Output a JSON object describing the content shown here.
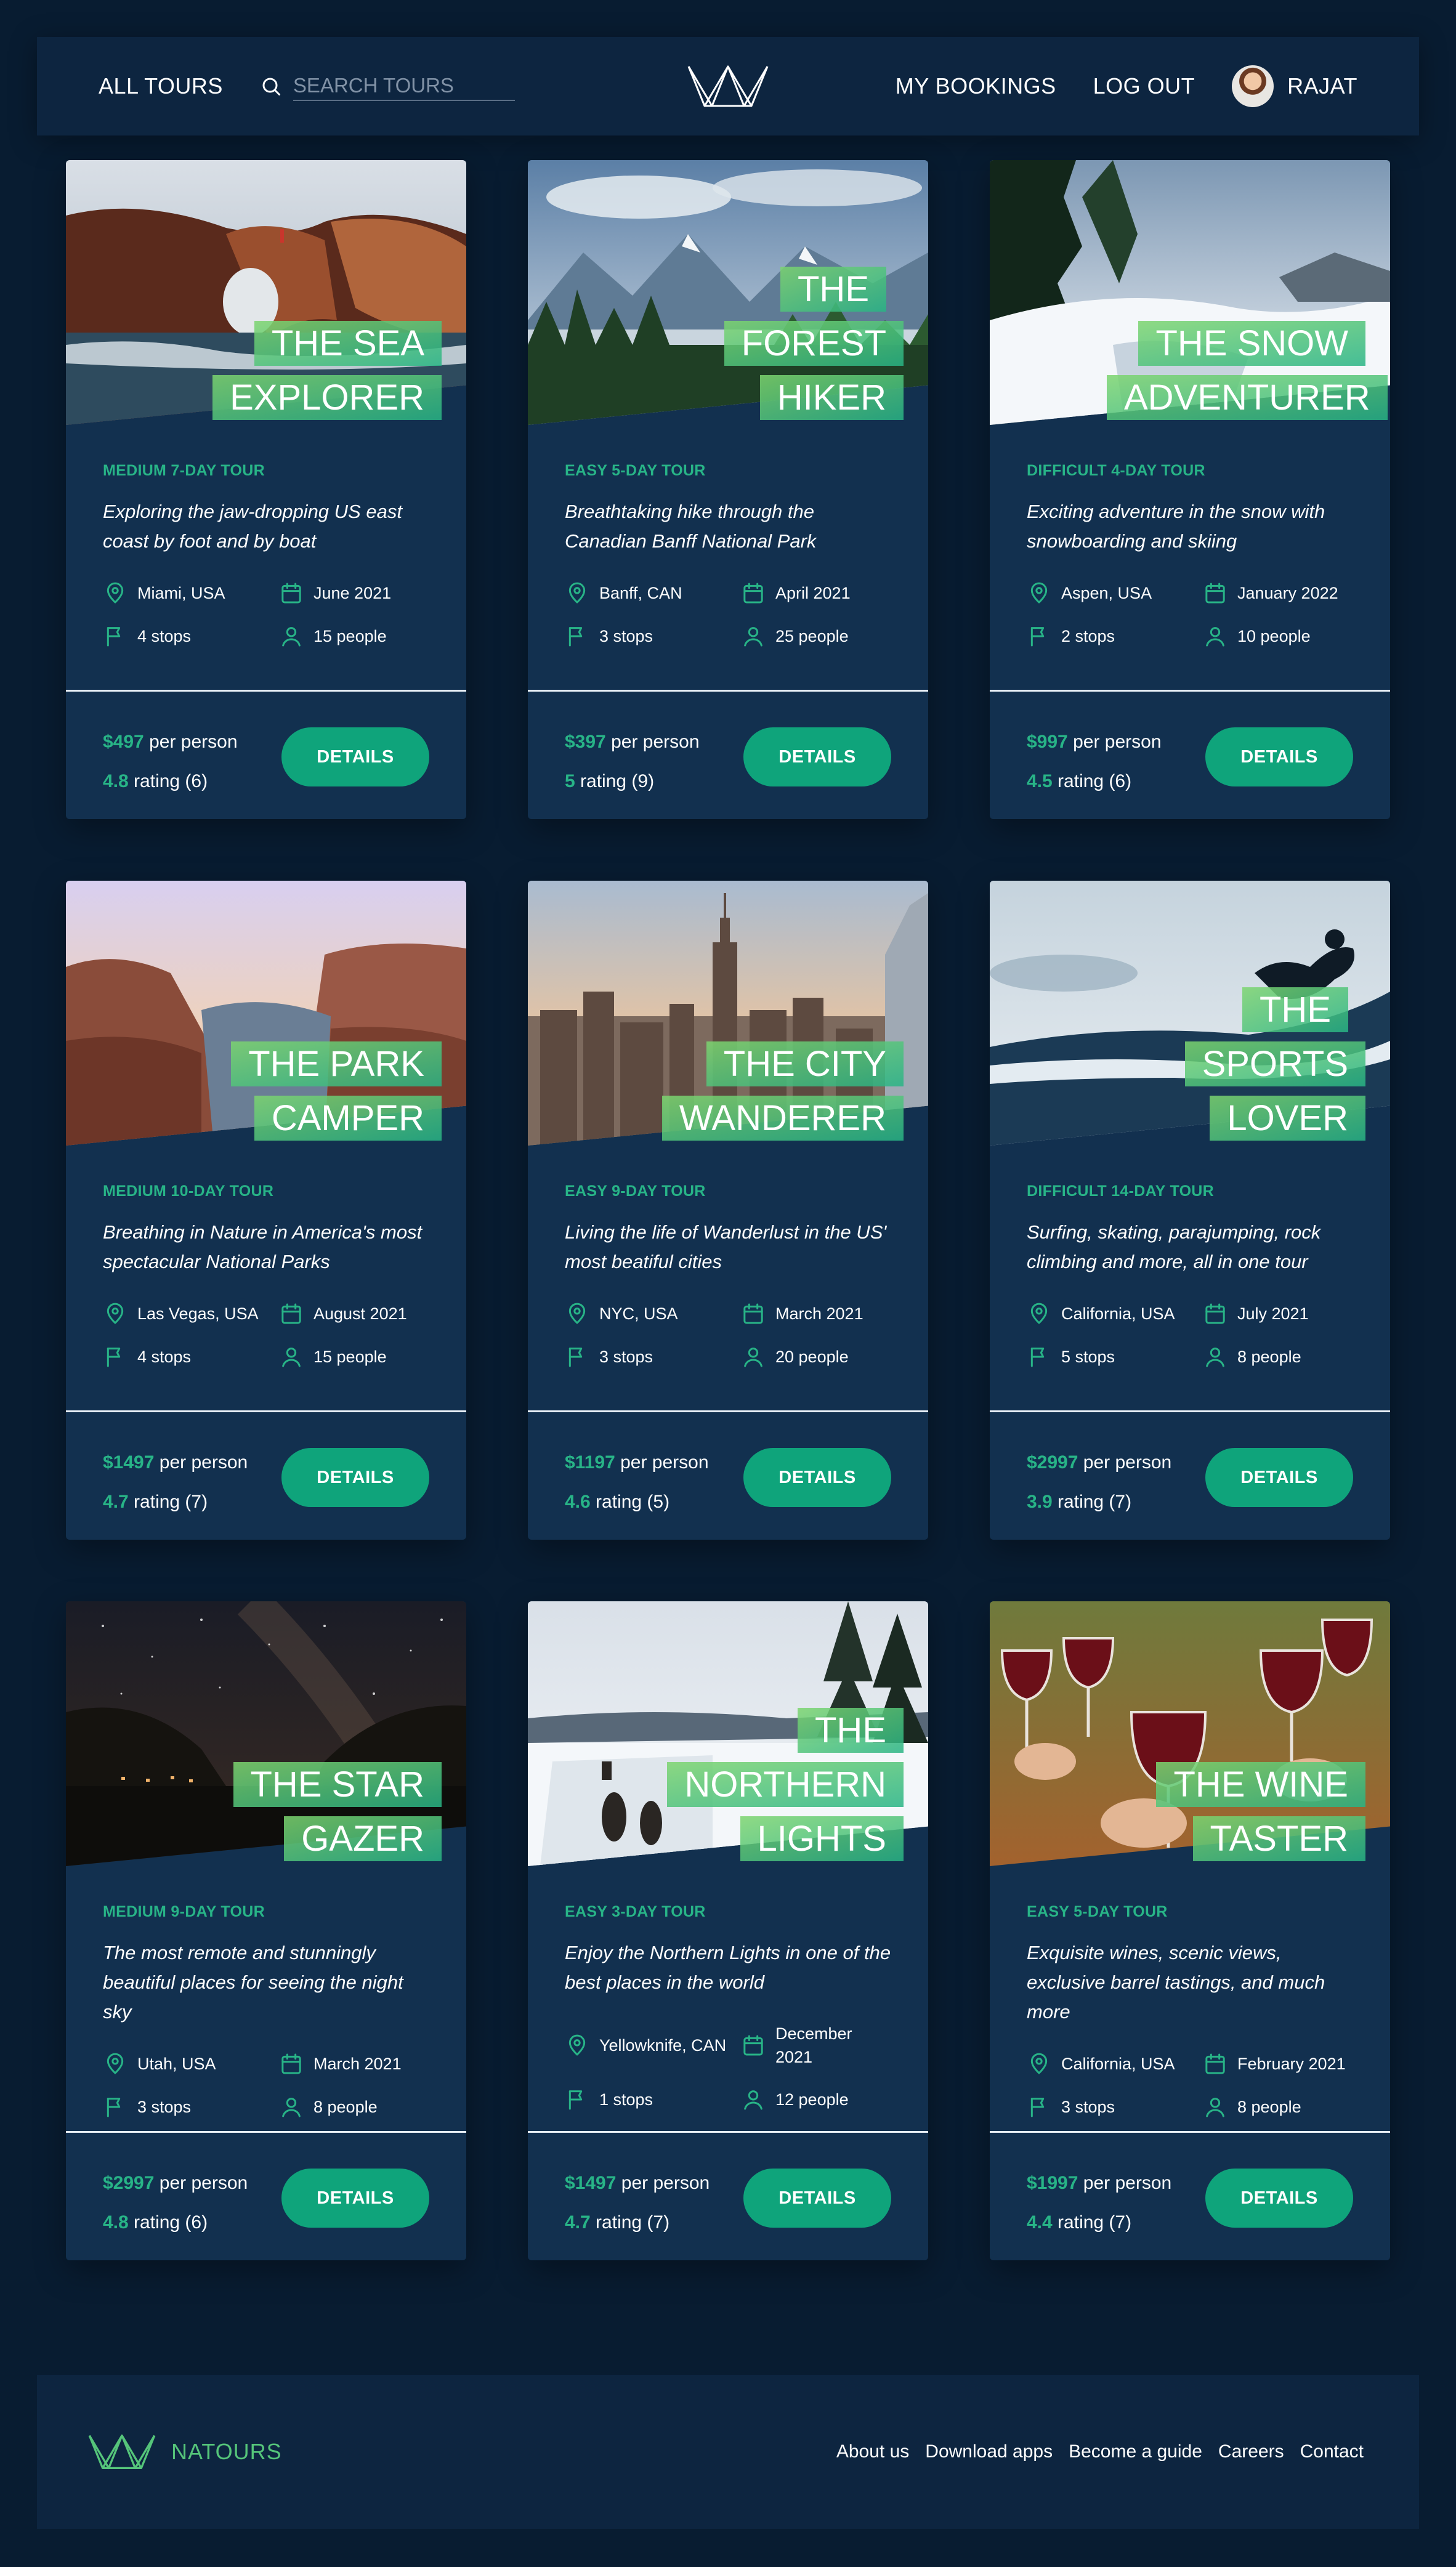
{
  "header": {
    "all_tours": "All tours",
    "search_placeholder": "Search tours",
    "my_bookings": "My bookings",
    "log_out": "Log out",
    "user_name": "RAJAT"
  },
  "tours": [
    {
      "title_lines": [
        "The Sea",
        "Explorer"
      ],
      "subheading": "Medium 7-day tour",
      "summary": "Exploring the jaw-dropping US east coast by foot and by boat",
      "location": "Miami, USA",
      "date": "June 2021",
      "stops": "4 stops",
      "people": "15 people",
      "price": "$497",
      "price_suffix": " per person",
      "rating": "4.8",
      "rating_suffix": " rating (6)",
      "button": "Details",
      "scene": "sea"
    },
    {
      "title_lines": [
        "The Forest",
        "Hiker"
      ],
      "subheading": "Easy 5-day tour",
      "summary": "Breathtaking hike through the Canadian Banff National Park",
      "location": "Banff, CAN",
      "date": "April 2021",
      "stops": "3 stops",
      "people": "25 people",
      "price": "$397",
      "price_suffix": " per person",
      "rating": "5",
      "rating_suffix": " rating (9)",
      "button": "Details",
      "scene": "forest"
    },
    {
      "title_lines": [
        "The Snow",
        "Adventurer"
      ],
      "subheading": "Difficult 4-day tour",
      "summary": "Exciting adventure in the snow with snowboarding and skiing",
      "location": "Aspen, USA",
      "date": "January 2022",
      "stops": "2 stops",
      "people": "10 people",
      "price": "$997",
      "price_suffix": " per person",
      "rating": "4.5",
      "rating_suffix": " rating (6)",
      "button": "Details",
      "scene": "snow"
    },
    {
      "title_lines": [
        "The Park",
        "Camper"
      ],
      "subheading": "Medium 10-day tour",
      "summary": "Breathing in Nature in America's most spectacular National Parks",
      "location": "Las Vegas, USA",
      "date": "August 2021",
      "stops": "4 stops",
      "people": "15 people",
      "price": "$1497",
      "price_suffix": " per person",
      "rating": "4.7",
      "rating_suffix": " rating (7)",
      "button": "Details",
      "scene": "park"
    },
    {
      "title_lines": [
        "The City",
        "Wanderer"
      ],
      "subheading": "Easy 9-day tour",
      "summary": "Living the life of Wanderlust in the US' most beatiful cities",
      "location": "NYC, USA",
      "date": "March 2021",
      "stops": "3 stops",
      "people": "20 people",
      "price": "$1197",
      "price_suffix": " per person",
      "rating": "4.6",
      "rating_suffix": " rating (5)",
      "button": "Details",
      "scene": "city"
    },
    {
      "title_lines": [
        "The Sports",
        "Lover"
      ],
      "subheading": "Difficult 14-day tour",
      "summary": "Surfing, skating, parajumping, rock climbing and more, all in one tour",
      "location": "California, USA",
      "date": "July 2021",
      "stops": "5 stops",
      "people": "8 people",
      "price": "$2997",
      "price_suffix": " per person",
      "rating": "3.9",
      "rating_suffix": " rating (7)",
      "button": "Details",
      "scene": "surf"
    },
    {
      "title_lines": [
        "The Star",
        "Gazer"
      ],
      "subheading": "Medium 9-day tour",
      "summary": "The most remote and stunningly beautiful places for seeing the night sky",
      "location": "Utah, USA",
      "date": "March 2021",
      "stops": "3 stops",
      "people": "8 people",
      "price": "$2997",
      "price_suffix": " per person",
      "rating": "4.8",
      "rating_suffix": " rating (6)",
      "button": "Details",
      "scene": "stars"
    },
    {
      "title_lines": [
        "The",
        "Northern",
        "Lights"
      ],
      "subheading": "Easy 3-day tour",
      "summary": "Enjoy the Northern Lights in one of the best places in the world",
      "location": "Yellowknife, CAN",
      "date": "December 2021",
      "stops": "1 stops",
      "people": "12 people",
      "price": "$1497",
      "price_suffix": " per person",
      "rating": "4.7",
      "rating_suffix": " rating (7)",
      "button": "Details",
      "scene": "northern"
    },
    {
      "title_lines": [
        "The Wine",
        "Taster"
      ],
      "subheading": "Easy 5-day tour",
      "summary": "Exquisite wines, scenic views, exclusive barrel tastings, and much more",
      "location": "California, USA",
      "date": "February 2021",
      "stops": "3 stops",
      "people": "8 people",
      "price": "$1997",
      "price_suffix": " per person",
      "rating": "4.4",
      "rating_suffix": " rating (7)",
      "button": "Details",
      "scene": "wine"
    }
  ],
  "footer": {
    "brand": "Natours",
    "links": [
      "About us",
      "Download apps",
      "Become a guide",
      "Careers",
      "Contact"
    ]
  },
  "colors": {
    "accent": "#28b487",
    "button": "#0fa47b",
    "card_bg": "#12304f",
    "page_bg": "#081c31"
  },
  "icons": {
    "location": "map-pin-icon",
    "date": "calendar-icon",
    "stops": "flag-icon",
    "people": "user-icon",
    "search": "search-icon",
    "logo": "crown-logo-icon"
  }
}
